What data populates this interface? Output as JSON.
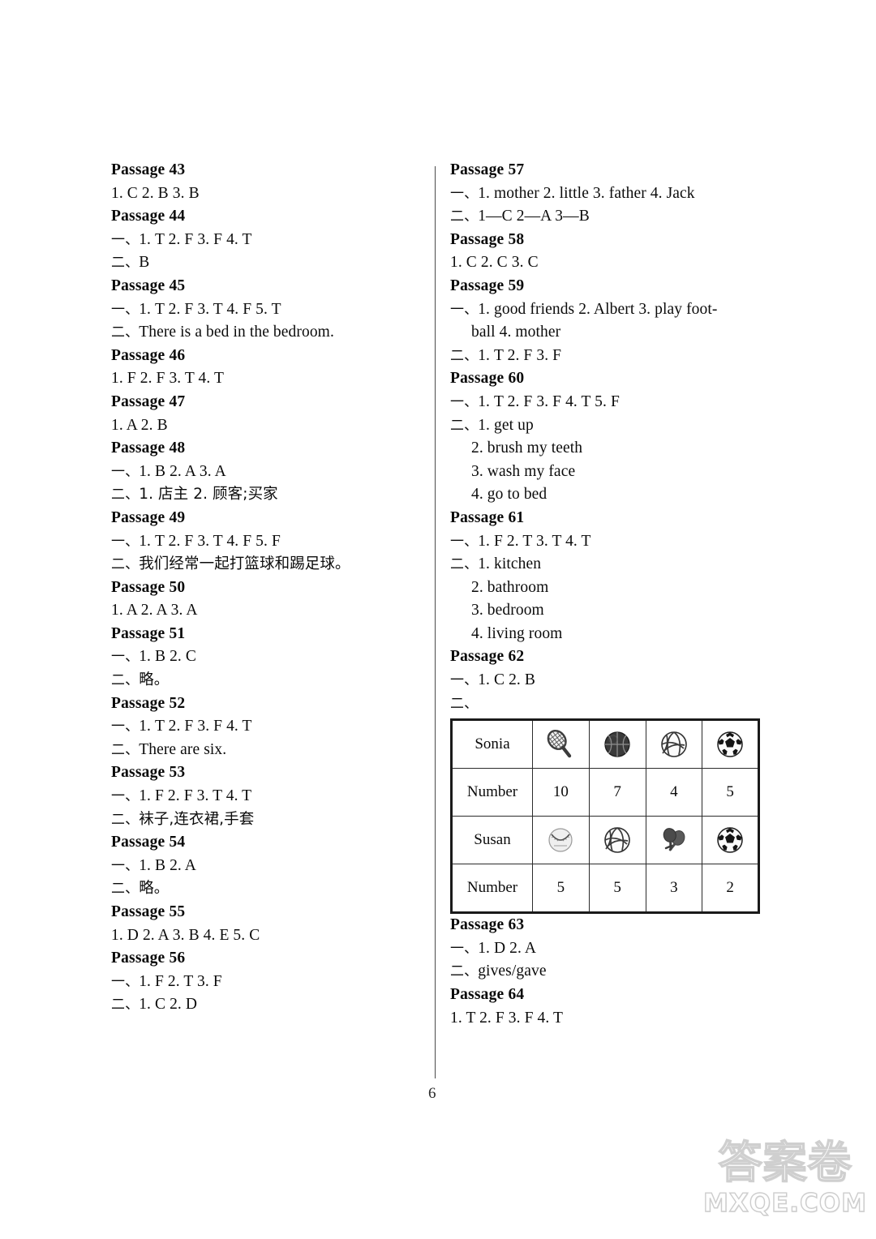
{
  "page": {
    "number": "6",
    "watermark_cn": "答案卷",
    "watermark_site": "MXQE.COM"
  },
  "left_column": [
    {
      "head": "Passage 43",
      "lines": [
        {
          "text": "1. C    2. B    3. B"
        }
      ]
    },
    {
      "head": "Passage 44",
      "lines": [
        {
          "enum": "一、",
          "text": "1. T    2. F    3. F    4. T"
        },
        {
          "enum": "二、",
          "text": "B"
        }
      ]
    },
    {
      "head": "Passage 45",
      "lines": [
        {
          "enum": "一、",
          "text": "1. T    2. F    3. T    4. F    5. T"
        },
        {
          "enum": "二、",
          "text": "There is a bed in the bedroom."
        }
      ]
    },
    {
      "head": "Passage 46",
      "lines": [
        {
          "text": "1. F    2. F    3. T    4. T"
        }
      ]
    },
    {
      "head": "Passage 47",
      "lines": [
        {
          "text": "1. A    2. B"
        }
      ]
    },
    {
      "head": "Passage 48",
      "lines": [
        {
          "enum": "一、",
          "text": "1. B    2. A    3. A"
        },
        {
          "enum": "二、",
          "text": "1. 店主    2. 顾客;买家",
          "cn": true
        }
      ]
    },
    {
      "head": "Passage 49",
      "lines": [
        {
          "enum": "一、",
          "text": "1. T    2. F    3. T    4. F    5. F"
        },
        {
          "enum": "二、",
          "text": "我们经常一起打篮球和踢足球。",
          "cn": true
        }
      ]
    },
    {
      "head": "Passage 50",
      "lines": [
        {
          "text": "1. A    2. A    3. A"
        }
      ]
    },
    {
      "head": "Passage 51",
      "lines": [
        {
          "enum": "一、",
          "text": "1. B    2. C"
        },
        {
          "enum": "二、",
          "text": "略。",
          "cn": true
        }
      ]
    },
    {
      "head": "Passage 52",
      "lines": [
        {
          "enum": "一、",
          "text": "1. T    2. F    3. F    4. T"
        },
        {
          "enum": "二、",
          "text": "There are six."
        }
      ]
    },
    {
      "head": "Passage 53",
      "lines": [
        {
          "enum": "一、",
          "text": "1. F    2. F    3. T    4. T"
        },
        {
          "enum": "二、",
          "text": "袜子,连衣裙,手套",
          "cn": true
        }
      ]
    },
    {
      "head": "Passage 54",
      "lines": [
        {
          "enum": "一、",
          "text": "1. B    2. A"
        },
        {
          "enum": "二、",
          "text": "略。",
          "cn": true
        }
      ]
    },
    {
      "head": "Passage 55",
      "lines": [
        {
          "text": "1. D    2. A    3. B    4. E    5. C"
        }
      ]
    },
    {
      "head": "Passage 56",
      "lines": [
        {
          "enum": "一、",
          "text": "1. F    2. T    3. F"
        },
        {
          "enum": "二、",
          "text": "1. C    2. D"
        }
      ]
    }
  ],
  "right_column": [
    {
      "head": "Passage 57",
      "lines": [
        {
          "enum": "一、",
          "text": "1. mother    2. little    3. father    4. Jack"
        },
        {
          "enum": "二、",
          "text": "1—C    2—A    3—B"
        }
      ]
    },
    {
      "head": "Passage 58",
      "lines": [
        {
          "text": "1. C    2. C    3. C"
        }
      ]
    },
    {
      "head": "Passage 59",
      "lines": [
        {
          "enum": "一、",
          "text": "1. good friends    2. Albert    3. play foot-"
        },
        {
          "indent": true,
          "text": "ball    4. mother"
        },
        {
          "enum": "二、",
          "text": "1. T    2. F    3. F"
        }
      ]
    },
    {
      "head": "Passage 60",
      "lines": [
        {
          "enum": "一、",
          "text": "1. T    2. F    3. F    4. T    5. F"
        },
        {
          "enum": "二、",
          "text": "1. get up"
        },
        {
          "indent": true,
          "text": "2. brush my teeth"
        },
        {
          "indent": true,
          "text": "3. wash my face"
        },
        {
          "indent": true,
          "text": "4. go to bed"
        }
      ]
    },
    {
      "head": "Passage 61",
      "lines": [
        {
          "enum": "一、",
          "text": "1. F    2. T    3. T    4. T"
        },
        {
          "enum": "二、",
          "text": "1. kitchen"
        },
        {
          "indent": true,
          "text": "2. bathroom"
        },
        {
          "indent": true,
          "text": "3. bedroom"
        },
        {
          "indent": true,
          "text": "4. living room"
        }
      ]
    },
    {
      "head": "Passage 62",
      "lines": [
        {
          "enum": "一、",
          "text": "1. C    2. B"
        },
        {
          "enum": "二、",
          "text": ""
        }
      ],
      "table": "sports"
    },
    {
      "head": "Passage 63",
      "lines": [
        {
          "enum": "一、",
          "text": "1. D    2. A"
        },
        {
          "enum": "二、",
          "text": "gives/gave"
        }
      ]
    },
    {
      "head": "Passage 64",
      "lines": [
        {
          "text": "1. T    2. F    3. F    4. T"
        }
      ]
    }
  ],
  "sports_table": {
    "rows": [
      {
        "label": "Sonia",
        "type": "icons",
        "cells": [
          "tennis-racket-icon",
          "basketball-icon",
          "volleyball-icon",
          "soccer-ball-icon"
        ]
      },
      {
        "label": "Number",
        "type": "numbers",
        "cells": [
          "10",
          "7",
          "4",
          "5"
        ]
      },
      {
        "label": "Susan",
        "type": "icons",
        "cells": [
          "baseball-icon",
          "volleyball-icon",
          "ping-pong-paddles-icon",
          "soccer-ball-icon"
        ]
      },
      {
        "label": "Number",
        "type": "numbers",
        "cells": [
          "5",
          "5",
          "3",
          "2"
        ]
      }
    ]
  }
}
